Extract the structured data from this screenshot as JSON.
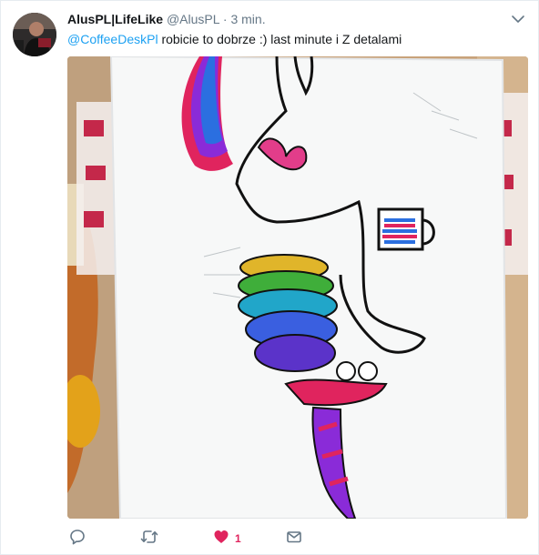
{
  "tweet": {
    "display_name": "AlusPL|LifeLike",
    "handle": "@AlusPL",
    "separator": "·",
    "time": "3 min.",
    "mention": "@CoffeeDeskPl",
    "text": " robicie to dobrze :) last minute i Z detalami"
  },
  "actions": {
    "reply_icon": "speech-bubble-icon",
    "retweet_icon": "retweet-arrows-icon",
    "like_icon": "heart-icon",
    "like_count": "1",
    "message_icon": "envelope-icon"
  },
  "colors": {
    "mention": "#1da1f2",
    "meta_text": "#657786",
    "like_active": "#e0245e",
    "action_icon": "#657786"
  }
}
